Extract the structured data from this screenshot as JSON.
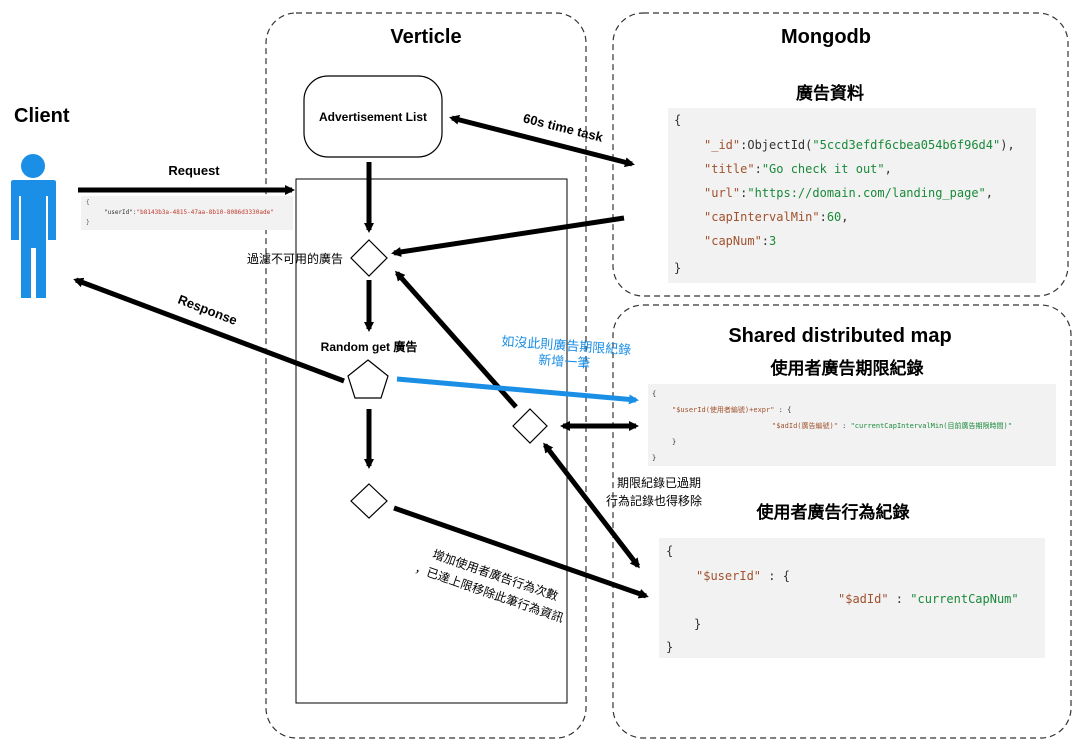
{
  "panels": {
    "client": "Client",
    "verticle": "Verticle",
    "mongodb": "Mongodb",
    "shared_map": "Shared distributed map"
  },
  "verticle": {
    "ad_list": "Advertisement List",
    "filter_node": "過濾不可用的廣告",
    "random_node": "Random get 廣告"
  },
  "arrows": {
    "request": "Request",
    "response": "Response",
    "time_task": "60s time task",
    "create_record": [
      "如沒此則廣告期限紀錄",
      "新增一筆"
    ],
    "expired": [
      "期限紀錄已過期",
      "行為記錄也得移除"
    ],
    "increment": [
      "增加使用者廣告行為次數",
      "，已達上限移除此筆行為資訊"
    ]
  },
  "request_payload": {
    "open": "{",
    "key": "\"userId\"",
    "sep": ":",
    "value": "\"b8143b3a-4815-47aa-8b10-8086d3330ade\"",
    "close": "}"
  },
  "mongo": {
    "heading": "廣告資料",
    "lines": [
      {
        "text": "{",
        "key": "",
        "value": ""
      },
      {
        "key": "\"_id\"",
        "sep": ":ObjectId(",
        "value": "\"5ccd3efdf6cbea054b6f96d4\"",
        "tail": "),"
      },
      {
        "key": "\"title\"",
        "sep": ":",
        "value": "\"Go check it out\"",
        "tail": ","
      },
      {
        "key": "\"url\"",
        "sep": ":",
        "value": "\"https://domain.com/landing_page\"",
        "tail": ","
      },
      {
        "key": "\"capIntervalMin\"",
        "sep": ":",
        "value": "60",
        "tail": ","
      },
      {
        "key": "\"capNum\"",
        "sep": ":",
        "value": "3",
        "tail": ""
      },
      {
        "text": "}",
        "key": "",
        "value": ""
      }
    ]
  },
  "cap_record": {
    "heading": "使用者廣告期限紀錄",
    "open": "{",
    "key": "\"$userId(使用者編號)+expr\"",
    "mid": " : {",
    "inner_key": "\"$adId(廣告編號)\"",
    "inner_sep": " : ",
    "inner_value": "\"currentCapIntervalMin(目前廣告期限時間)\"",
    "inner_close": "}",
    "close": "}"
  },
  "behavior_record": {
    "heading": "使用者廣告行為紀錄",
    "open": "{",
    "key": "\"$userId\"",
    "mid": " : {",
    "inner_key": "\"$adId\"",
    "inner_sep": " : ",
    "inner_value": "\"currentCapNum\"",
    "inner_close": "}",
    "close": "}"
  },
  "colors": {
    "key": "#a0522d",
    "string": "#1a8a3a",
    "number": "#1a8a3a",
    "red_value": "#c0392b",
    "blue_arrow": "#1b8fe6",
    "client": "#1b8fe6",
    "code_bg": "#f2f2f2"
  },
  "icons": {
    "client": "person-icon"
  }
}
